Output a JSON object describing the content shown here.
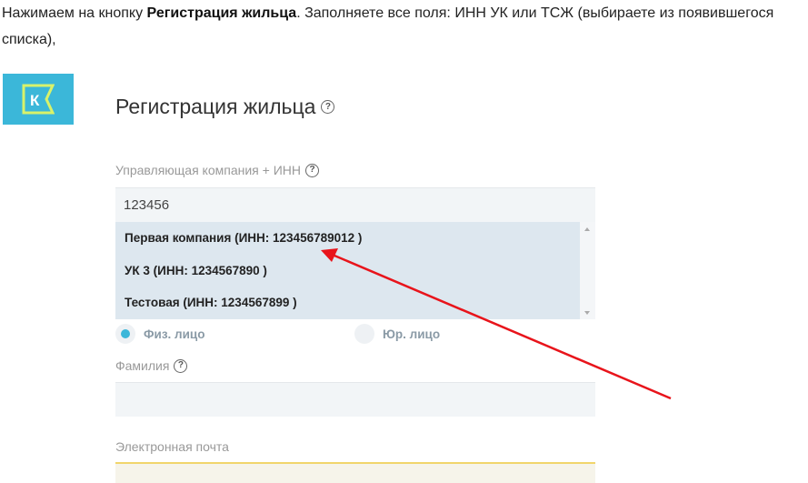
{
  "instructions": {
    "before": "Нажимаем на кнопку ",
    "bold": "Регистрация жильца",
    "after": ". Заполняете все поля: ИНН УК или ТСЖ (выбираете из появившегося списка),"
  },
  "logo": {
    "letter": "К",
    "bg_color": "#3bb7d9"
  },
  "page": {
    "title": "Регистрация жильца",
    "help_glyph": "?"
  },
  "company_field": {
    "label": "Управляющая компания + ИНН",
    "value": "123456",
    "options": [
      "Первая компания (ИНН: 123456789012 )",
      "УК 3 (ИНН: 1234567890 )",
      "Тестовая (ИНН: 1234567899 )"
    ]
  },
  "person_type": {
    "individual": "Физ. лицо",
    "legal": "Юр. лицо",
    "selected": "individual"
  },
  "surname_field": {
    "label": "Фамилия",
    "value": ""
  },
  "email_field": {
    "label": "Электронная почта",
    "value": ""
  },
  "annotation": {
    "arrow_color": "#e8141b"
  }
}
